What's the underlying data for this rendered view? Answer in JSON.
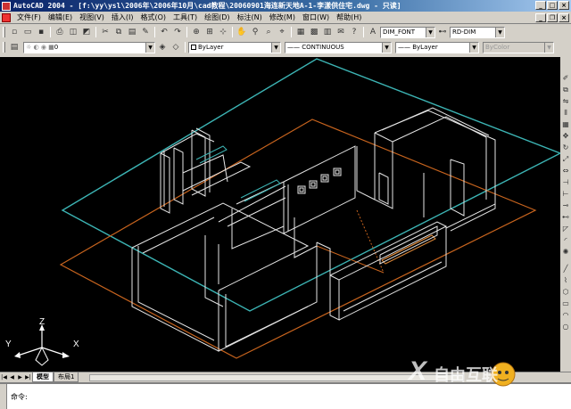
{
  "window": {
    "title": "AutoCAD 2004 - [f:\\yy\\ysl\\2006年\\2006年10月\\cad教程\\20060901海连新天地A-1-李漾供住宅.dwg - 只读]"
  },
  "menubar": {
    "items": [
      {
        "label": "文件(F)"
      },
      {
        "label": "编辑(E)"
      },
      {
        "label": "视图(V)"
      },
      {
        "label": "插入(I)"
      },
      {
        "label": "格式(O)"
      },
      {
        "label": "工具(T)"
      },
      {
        "label": "绘图(D)"
      },
      {
        "label": "标注(N)"
      },
      {
        "label": "修改(M)"
      },
      {
        "label": "窗口(W)"
      },
      {
        "label": "帮助(H)"
      }
    ]
  },
  "toolbar_styles": {
    "text_style": "DIM_FONT",
    "dim_style": "RD-DIM"
  },
  "properties": {
    "layer": "0",
    "color": "ByLayer",
    "linetype": "CONTINUOUS",
    "lineweight": "ByLayer",
    "plotstyle": "ByColor"
  },
  "ucs": {
    "x_label": "X",
    "y_label": "Y",
    "z_label": "Z"
  },
  "tabs": {
    "model": "模型",
    "layout1": "布局1"
  },
  "command": {
    "prompt": "命令:"
  },
  "watermark": {
    "text": "自由互联"
  },
  "colors": {
    "cyan_outline": "#3cb4b4",
    "orange_outline": "#c8641e",
    "walls": "#e6e6e6",
    "title_bar": "#0a246a"
  }
}
